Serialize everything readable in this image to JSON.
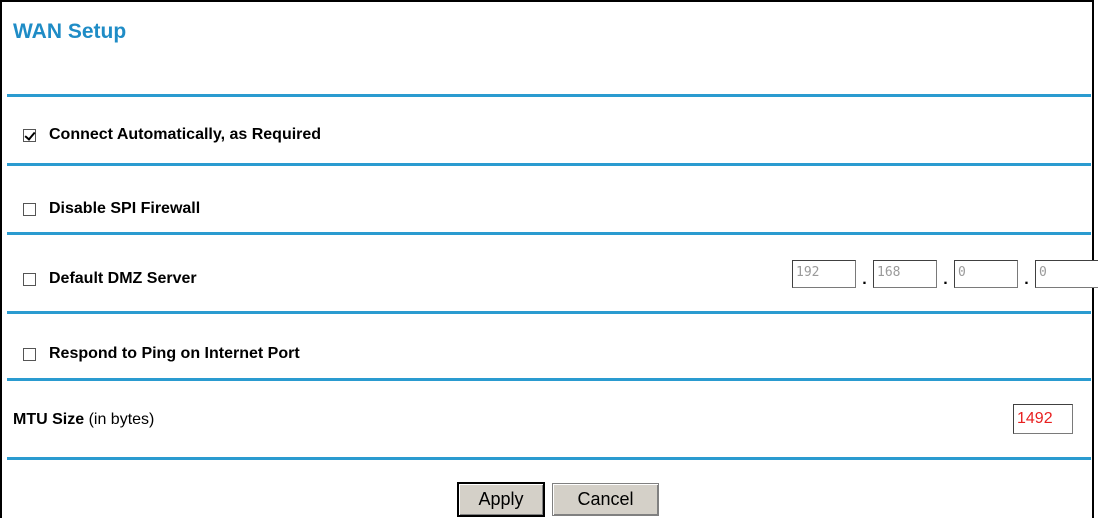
{
  "page": {
    "title": "WAN Setup"
  },
  "options": [
    {
      "label": "Connect Automatically, as Required",
      "checked": true
    },
    {
      "label": "Disable SPI Firewall",
      "checked": false
    },
    {
      "label": "Default DMZ Server",
      "checked": false
    },
    {
      "label": "Respond to Ping on Internet Port",
      "checked": false
    }
  ],
  "dmz": {
    "octets": [
      "192",
      "168",
      "0",
      "0"
    ],
    "separator": "."
  },
  "mtu": {
    "label": "MTU Size",
    "unit": "(in bytes)",
    "value": "1492"
  },
  "buttons": {
    "apply": "Apply",
    "cancel": "Cancel"
  },
  "colors": {
    "accent": "#1f8cc6",
    "rule": "#2a9bd0",
    "mtu_value": "#e82020"
  }
}
